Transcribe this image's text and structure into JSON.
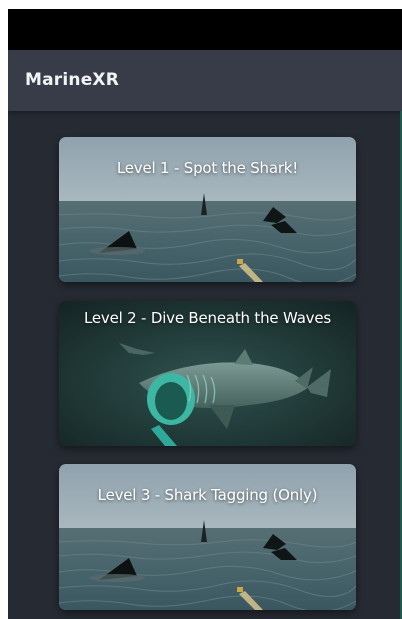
{
  "app_bar": {
    "title": "MarineXR"
  },
  "levels": [
    {
      "label": "Level 1 - Spot the Shark!",
      "thumbnail": "ocean-surface-shark-fins"
    },
    {
      "label": "Level 2 - Dive Beneath the Waves",
      "thumbnail": "underwater-basking-shark"
    },
    {
      "label": "Level 3 - Shark Tagging (Only)",
      "thumbnail": "ocean-surface-shark-fins"
    }
  ],
  "colors": {
    "background": "#262a33",
    "app_bar": "#383c48",
    "status_bar": "#000000"
  }
}
